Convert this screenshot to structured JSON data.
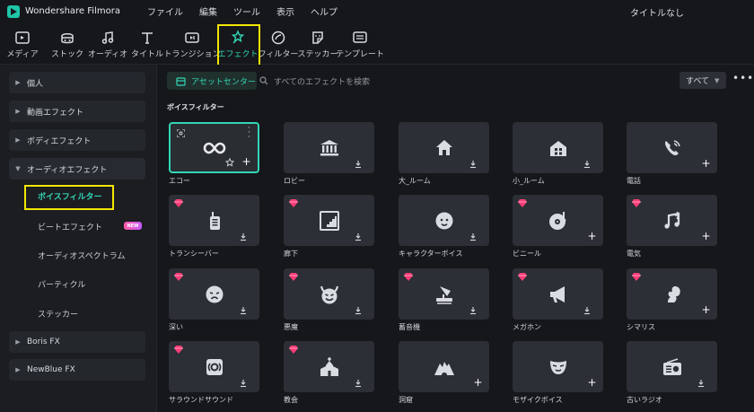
{
  "app": {
    "name": "Wondershare Filmora",
    "document_title": "タイトルなし",
    "brand_color": "#1fc6a8",
    "accent_color": "#33d6b6",
    "highlight_color": "#f4e500"
  },
  "menu": [
    "ファイル",
    "編集",
    "ツール",
    "表示",
    "ヘルプ"
  ],
  "toolbar": [
    {
      "label": "メディア",
      "icon": "media-icon"
    },
    {
      "label": "ストック",
      "icon": "stock-icon"
    },
    {
      "label": "オーディオ",
      "icon": "audio-icon"
    },
    {
      "label": "タイトル",
      "icon": "title-icon"
    },
    {
      "label": "トランジション",
      "icon": "transition-icon"
    },
    {
      "label": "エフェクト",
      "icon": "effect-icon",
      "active": true
    },
    {
      "label": "フィルター",
      "icon": "filter-icon"
    },
    {
      "label": "ステッカー",
      "icon": "sticker-icon"
    },
    {
      "label": "テンプレート",
      "icon": "template-icon"
    }
  ],
  "sidebar": {
    "groups": [
      {
        "label": "個人"
      },
      {
        "label": "動画エフェクト"
      },
      {
        "label": "ボディエフェクト"
      },
      {
        "label": "オーディオエフェクト",
        "expanded": true
      }
    ],
    "sub_items": [
      {
        "label": "ボイスフィルター",
        "active": true
      },
      {
        "label": "ビートエフェクト",
        "badge": "NEW"
      },
      {
        "label": "オーディオスペクトラム"
      },
      {
        "label": "パーティクル"
      },
      {
        "label": "ステッカー"
      }
    ],
    "bottom_groups": [
      {
        "label": "Boris FX"
      },
      {
        "label": "NewBlue FX"
      }
    ]
  },
  "main": {
    "asset_center_label": "アセットセンター",
    "search_placeholder": "すべてのエフェクトを検索",
    "filter_value": "すべて",
    "section_title": "ボイスフィルター"
  },
  "effects": [
    {
      "label": "エコー",
      "icon": "infinity-icon",
      "premium": false,
      "action": "add",
      "selected": true
    },
    {
      "label": "ロビー",
      "icon": "bank-icon",
      "premium": false,
      "action": "download"
    },
    {
      "label": "大_ルーム",
      "icon": "house-icon",
      "premium": false,
      "action": "download"
    },
    {
      "label": "小_ルーム",
      "icon": "small-house-icon",
      "premium": false,
      "action": "download"
    },
    {
      "label": "電話",
      "icon": "phone-icon",
      "premium": false,
      "action": "add"
    },
    {
      "label": "トランシーバー",
      "icon": "walkie-talkie-icon",
      "premium": true,
      "action": "download"
    },
    {
      "label": "廊下",
      "icon": "stairs-icon",
      "premium": true,
      "action": "download"
    },
    {
      "label": "キャラクターボイス",
      "icon": "baby-face-icon",
      "premium": false,
      "action": "download"
    },
    {
      "label": "ビニール",
      "icon": "vinyl-icon",
      "premium": true,
      "action": "add"
    },
    {
      "label": "電気",
      "icon": "music-note-icon",
      "premium": true,
      "action": "add"
    },
    {
      "label": "深い",
      "icon": "sad-face-icon",
      "premium": true,
      "action": "download"
    },
    {
      "label": "悪魔",
      "icon": "devil-icon",
      "premium": true,
      "action": "download"
    },
    {
      "label": "蓄音機",
      "icon": "gramophone-icon",
      "premium": true,
      "action": "download"
    },
    {
      "label": "メガホン",
      "icon": "megaphone-icon",
      "premium": true,
      "action": "download"
    },
    {
      "label": "シマリス",
      "icon": "squirrel-icon",
      "premium": true,
      "action": "add"
    },
    {
      "label": "サラウンドサウンド",
      "icon": "surround-icon",
      "premium": true,
      "action": "download"
    },
    {
      "label": "教会",
      "icon": "church-icon",
      "premium": true,
      "action": "download"
    },
    {
      "label": "洞窟",
      "icon": "cave-icon",
      "premium": false,
      "action": "add"
    },
    {
      "label": "モザイクボイス",
      "icon": "mask-icon",
      "premium": false,
      "action": "add"
    },
    {
      "label": "古いラジオ",
      "icon": "radio-icon",
      "premium": false,
      "action": "download"
    }
  ]
}
